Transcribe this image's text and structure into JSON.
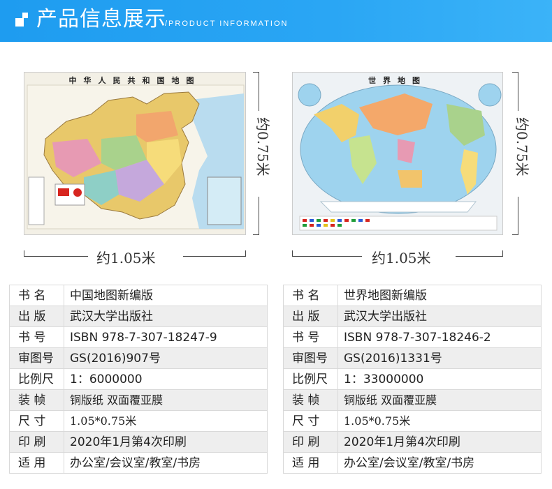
{
  "header": {
    "title": "产品信息展示",
    "subtitle": "/PRODUCT INFORMATION"
  },
  "maps": {
    "china": {
      "title": "中华人民共和国地图"
    },
    "world": {
      "title": "世界地图"
    }
  },
  "dimensions": {
    "china_width": "约1.05米",
    "china_height": "约0.75米",
    "world_width": "约1.05米",
    "world_height": "约0.75米"
  },
  "colors": {
    "header_blue": "#1e9cf0",
    "ocean": "#9ed3ee",
    "row_alt": "#eeeeee"
  },
  "left_table": [
    {
      "key": "书 名",
      "value": "中国地图新编版"
    },
    {
      "key": "出 版",
      "value": "武汉大学出版社"
    },
    {
      "key": "书 号",
      "value": "ISBN 978-7-307-18247-9"
    },
    {
      "key": "审图号",
      "value": "GS(2016)907号"
    },
    {
      "key": "比例尺",
      "value": "1：6000000"
    },
    {
      "key": "装 帧",
      "value": "铜版纸 双面覆亚膜"
    },
    {
      "key": "尺 寸",
      "value": "1.05*0.75米"
    },
    {
      "key": "印 刷",
      "value": "2020年1月第4次印刷"
    },
    {
      "key": "适 用",
      "value": "办公室/会议室/教室/书房"
    }
  ],
  "right_table": [
    {
      "key": "书 名",
      "value": "世界地图新编版"
    },
    {
      "key": "出 版",
      "value": "武汉大学出版社"
    },
    {
      "key": "书 号",
      "value": "ISBN 978-7-307-18246-2"
    },
    {
      "key": "审图号",
      "value": "GS(2016)1331号"
    },
    {
      "key": "比例尺",
      "value": "1：33000000"
    },
    {
      "key": "装 帧",
      "value": "铜版纸 双面覆亚膜"
    },
    {
      "key": "尺 寸",
      "value": "1.05*0.75米"
    },
    {
      "key": "印 刷",
      "value": "2020年1月第4次印刷"
    },
    {
      "key": "适 用",
      "value": "办公室/会议室/教室/书房"
    }
  ]
}
